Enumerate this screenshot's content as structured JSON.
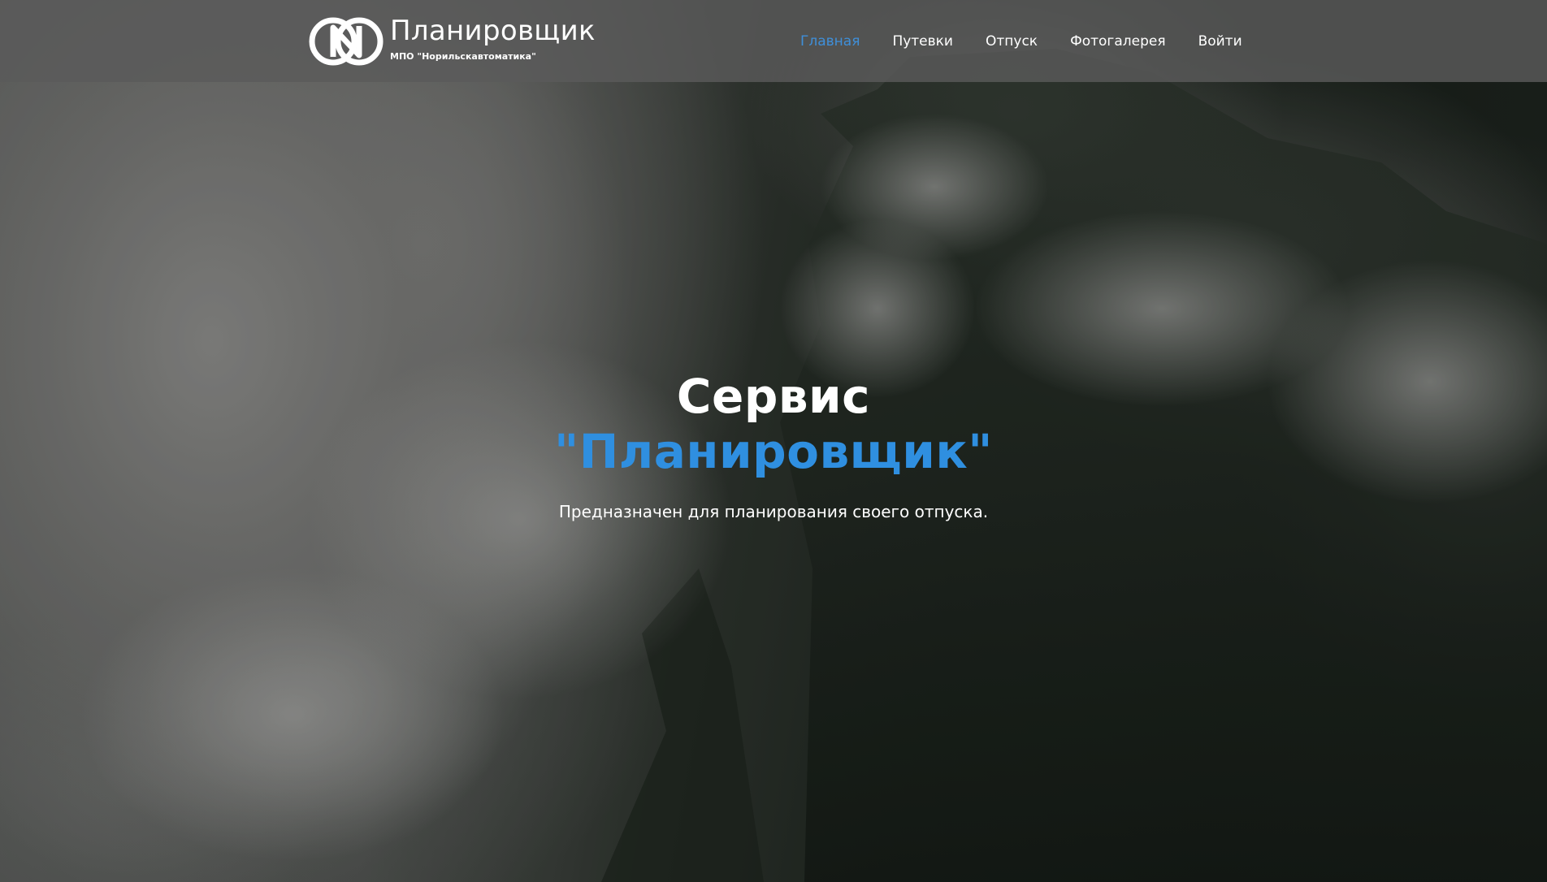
{
  "header": {
    "brand_title": "Планировщик",
    "brand_subtitle": "МПО \"Норильскавтоматика\"",
    "logo_icon": "n-circle-logo-icon"
  },
  "nav": {
    "items": [
      {
        "label": "Главная",
        "active": true
      },
      {
        "label": "Путевки",
        "active": false
      },
      {
        "label": "Отпуск",
        "active": false
      },
      {
        "label": "Фотогалерея",
        "active": false
      },
      {
        "label": "Войти",
        "active": false
      }
    ]
  },
  "hero": {
    "line1": "Сервис",
    "line2": "\"Планировщик\"",
    "description": "Предназначен для планирования своего отпуска."
  },
  "colors": {
    "accent": "#2f8fe0",
    "nav_active": "#3f8fd9",
    "header_bg": "#5a5a5a"
  }
}
